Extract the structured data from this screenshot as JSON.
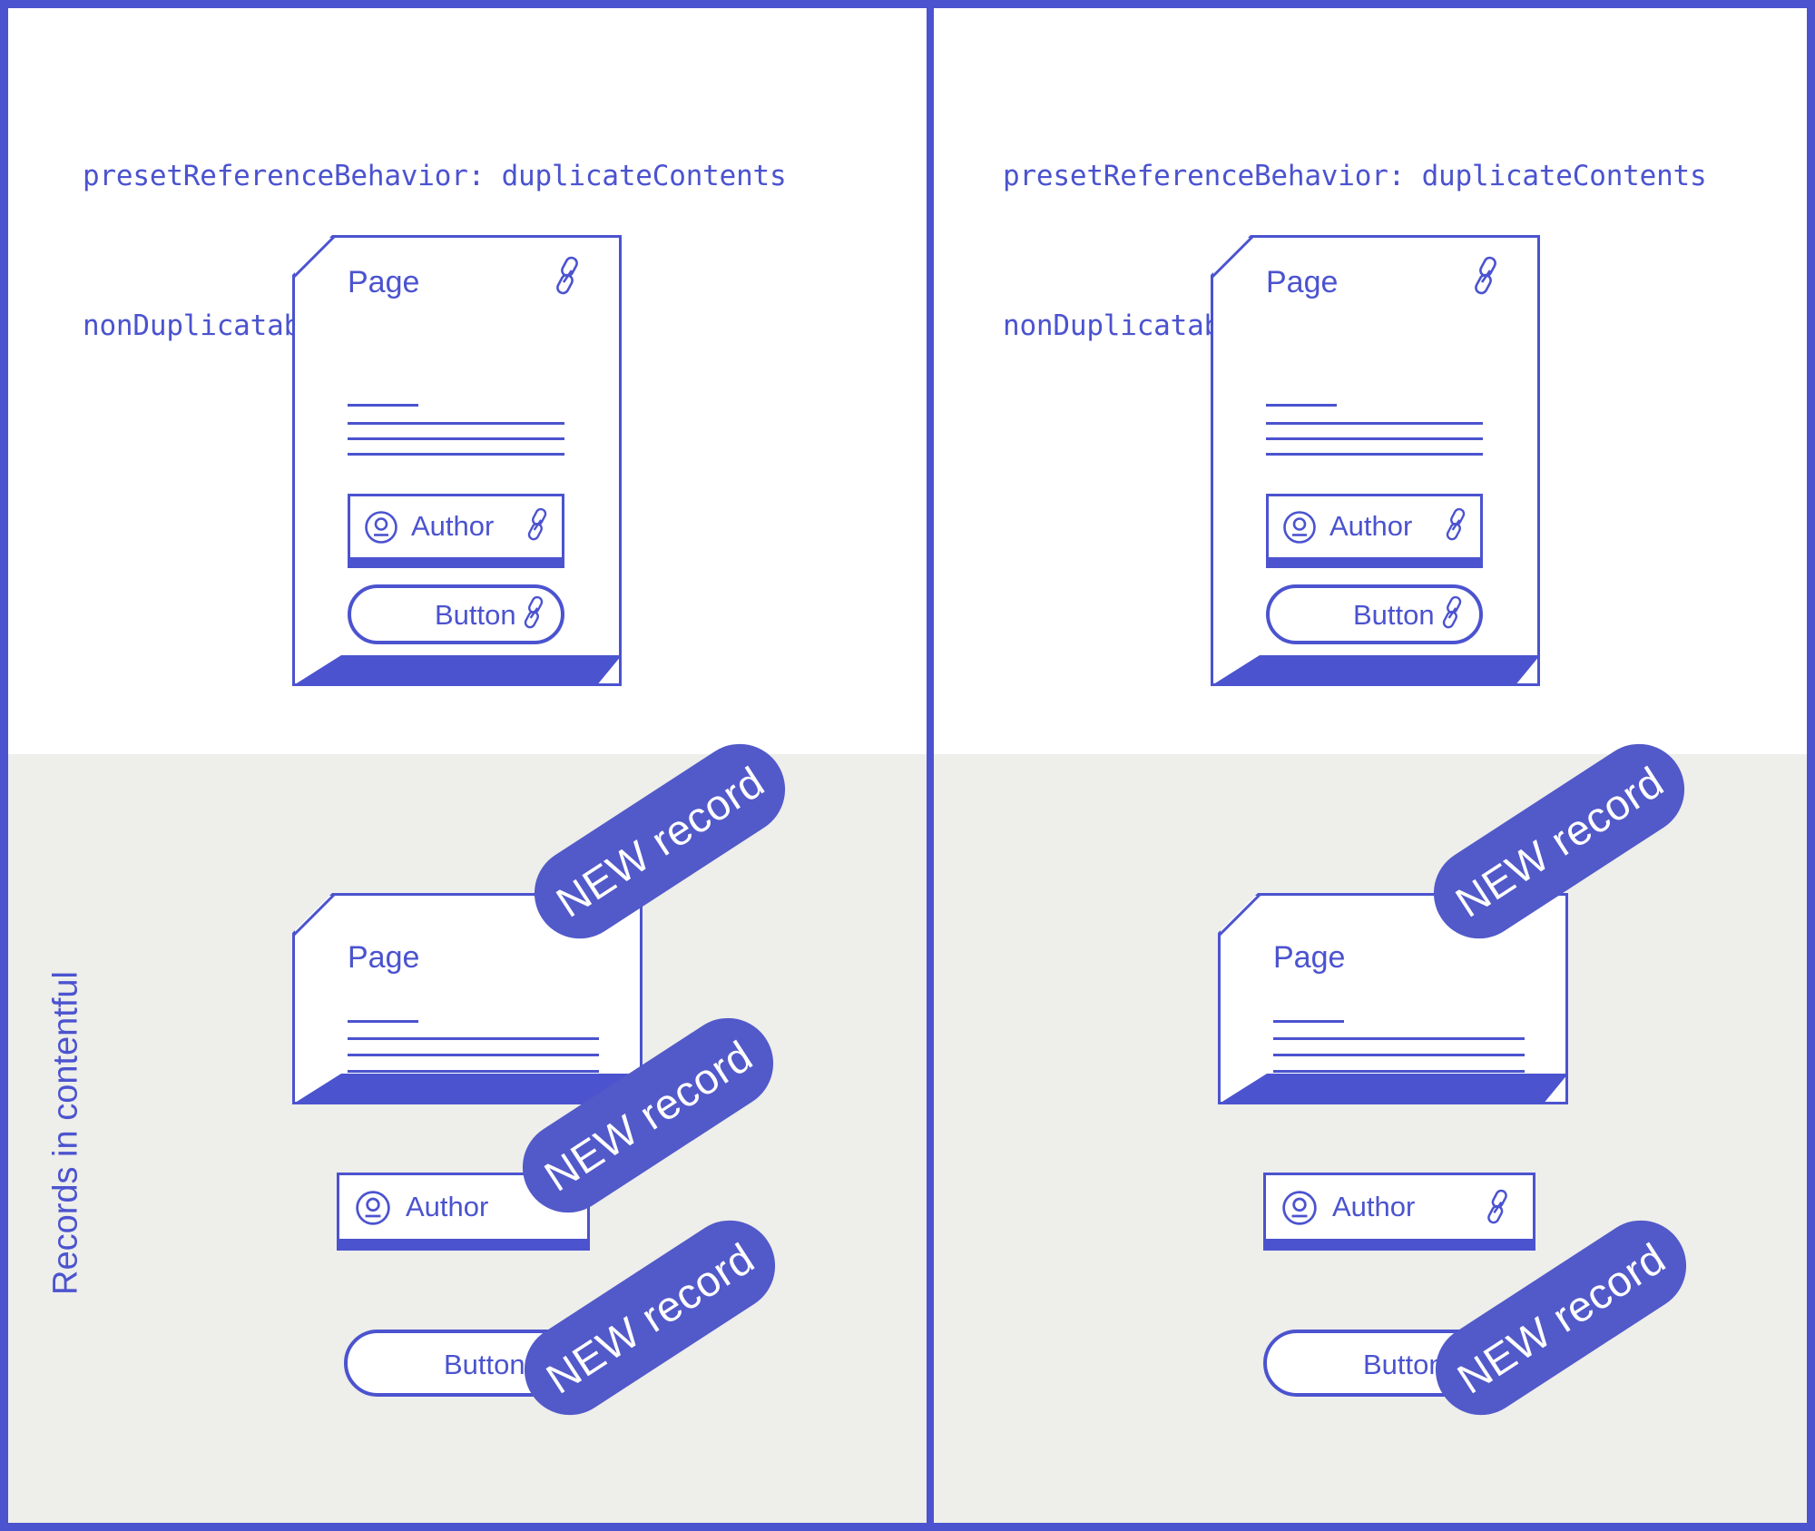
{
  "theme": {
    "accent": "#4b53cf",
    "badge_fill": "#5259c9",
    "band_bg": "#eeeeea",
    "panel_bg": "#ffffff",
    "text_on_badge": "#ffffff"
  },
  "side_label": "Records in contentful",
  "panels": [
    {
      "id": "left",
      "config": {
        "line1": "presetReferenceBehavior: duplicateContents",
        "line2": "nonDuplicatableModels: []"
      },
      "source_card": {
        "title": "Page",
        "link_icon": "link-icon",
        "author": {
          "label": "Author",
          "avatar_icon": "user-circle-icon",
          "link_icon": "link-icon"
        },
        "button": {
          "label": "Button",
          "link_icon": "link-icon"
        }
      },
      "records": {
        "page": {
          "title": "Page",
          "badge": "NEW record"
        },
        "author": {
          "label": "Author",
          "avatar_icon": "user-circle-icon",
          "badge": "NEW record",
          "has_link_icon": false
        },
        "button": {
          "label": "Button",
          "badge": "NEW record"
        }
      }
    },
    {
      "id": "right",
      "config": {
        "line1": "presetReferenceBehavior: duplicateContents",
        "line2": "nonDuplicatableModels: [author]"
      },
      "source_card": {
        "title": "Page",
        "link_icon": "link-icon",
        "author": {
          "label": "Author",
          "avatar_icon": "user-circle-icon",
          "link_icon": "link-icon"
        },
        "button": {
          "label": "Button",
          "link_icon": "link-icon"
        }
      },
      "records": {
        "page": {
          "title": "Page",
          "badge": "NEW record"
        },
        "author": {
          "label": "Author",
          "avatar_icon": "user-circle-icon",
          "badge": "",
          "has_link_icon": true,
          "link_icon": "link-icon"
        },
        "button": {
          "label": "Button",
          "badge": "NEW record"
        }
      }
    }
  ]
}
